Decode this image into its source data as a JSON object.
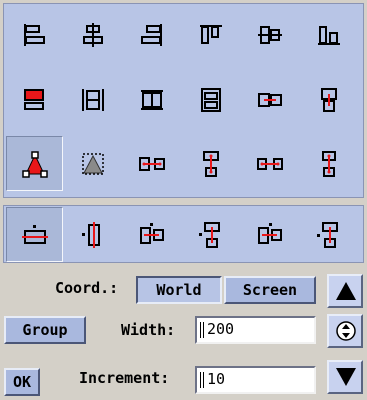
{
  "icons": {
    "align_grid": [
      "align-left-icon",
      "align-center-horizontal-icon",
      "align-right-icon",
      "align-top-icon",
      "align-center-vertical-icon",
      "align-bottom-icon",
      "same-height-red-icon",
      "distribute-horizontal-icon",
      "distribute-vertical-icon",
      "distribute-box-icon",
      "center-horizontal-connector-icon",
      "center-vertical-connector-icon",
      "triangle-red-selected-icon",
      "triangle-gray-icon",
      "equal-horizontal-spacing-icon",
      "equal-vertical-spacing-icon",
      "link-horizontal-red-icon",
      "link-vertical-red-icon"
    ],
    "constraint_row": [
      "horizontal-center-constraint-icon",
      "vertical-center-constraint-icon",
      "offset-horizontal-constraint-icon",
      "offset-vertical-constraint-icon",
      "offset-box-horizontal-icon",
      "offset-box-vertical-icon"
    ]
  },
  "coords": {
    "label": "Coord.:",
    "world": "World",
    "screen": "Screen"
  },
  "group_button": "Group",
  "width": {
    "label": "Width:",
    "value": "200"
  },
  "increment": {
    "label": "Increment:",
    "value": "10"
  },
  "ok_button": "OK",
  "colors": {
    "panel": "#b8c5e6",
    "button": "#a9b8de",
    "red": "#e8171a"
  }
}
